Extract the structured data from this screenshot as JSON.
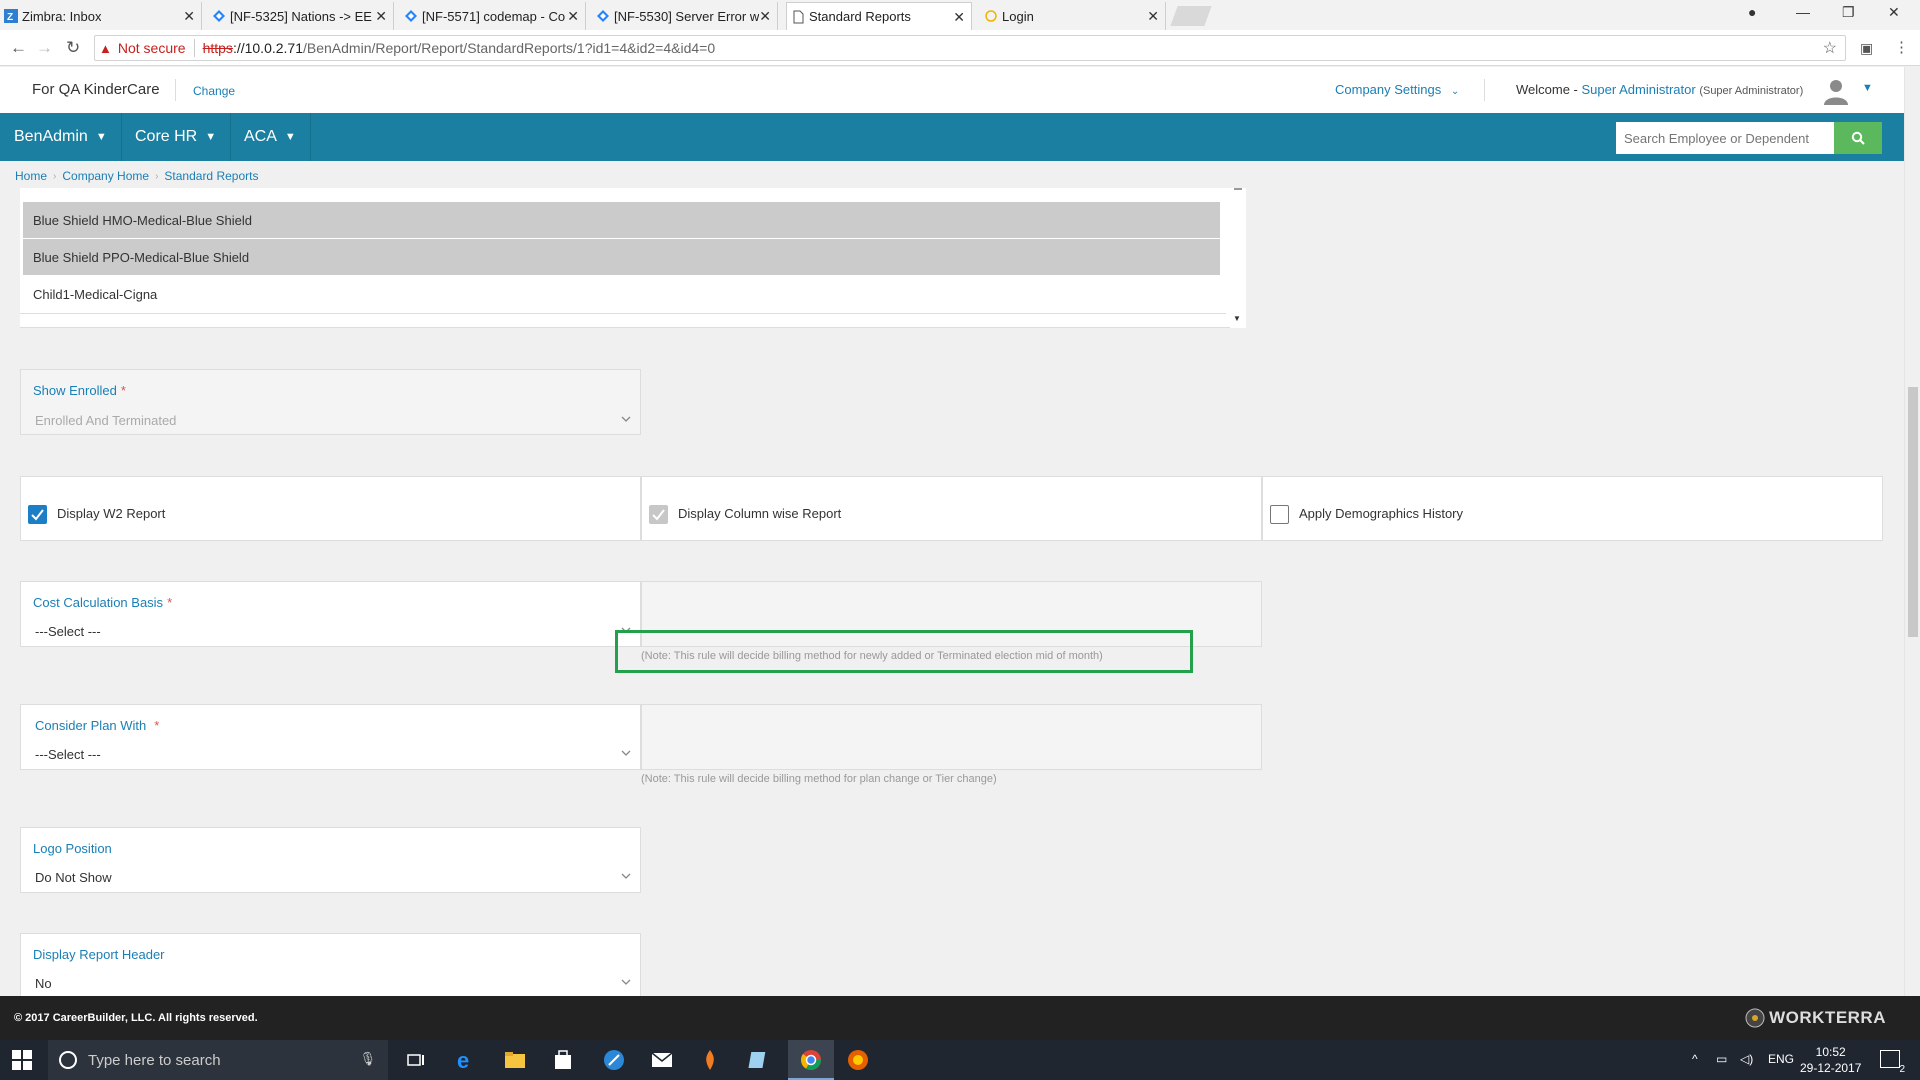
{
  "browser": {
    "tabs": [
      {
        "label": "Zimbra: Inbox",
        "icon": "zimbra-icon"
      },
      {
        "label": "[NF-5325] Nations -> EE",
        "icon": "jira-icon"
      },
      {
        "label": "[NF-5571] codemap - Co",
        "icon": "jira-icon"
      },
      {
        "label": "[NF-5530] Server Error w",
        "icon": "jira-icon"
      },
      {
        "label": "Standard Reports",
        "icon": "page-icon"
      },
      {
        "label": "Login",
        "icon": "loading-icon"
      }
    ],
    "not_secure": "Not secure",
    "url_scheme": "https",
    "url_host": "://10.0.2.71",
    "url_path": "/BenAdmin/Report/Report/StandardReports/1?id1=4&id2=4&id4=0"
  },
  "header": {
    "company": "For QA KinderCare",
    "change": "Change",
    "company_settings": "Company Settings",
    "welcome": "Welcome -",
    "user": "Super Administrator",
    "role": "(Super Administrator)"
  },
  "nav": {
    "items": [
      "BenAdmin",
      "Core HR",
      "ACA"
    ],
    "search_placeholder": "Search Employee or Dependent"
  },
  "breadcrumb": [
    "Home",
    "Company Home",
    "Standard Reports"
  ],
  "plans": [
    {
      "label": "Blue Shield HMO-Medical-Blue Shield",
      "selected": true
    },
    {
      "label": "Blue Shield PPO-Medical-Blue Shield",
      "selected": true
    },
    {
      "label": "Child1-Medical-Cigna",
      "selected": false
    }
  ],
  "form": {
    "show_enrolled": {
      "label": "Show Enrolled",
      "value": "Enrolled And Terminated"
    },
    "checkboxes": [
      {
        "label": "Display W2 Report",
        "state": "checked"
      },
      {
        "label": "Display Column wise Report",
        "state": "disabled-checked"
      },
      {
        "label": "Apply Demographics History",
        "state": "unchecked"
      }
    ],
    "cost_basis": {
      "label": "Cost Calculation Basis",
      "value": "---Select ---",
      "note": "(Note: This rule will decide billing method for newly added or Terminated election mid of month)"
    },
    "consider_plan": {
      "label": "Consider Plan With",
      "value": "---Select ---",
      "note": "(Note: This rule will decide billing method for plan change or Tier change)"
    },
    "logo_position": {
      "label": "Logo Position",
      "value": "Do Not Show"
    },
    "report_header": {
      "label": "Display Report Header",
      "value": "No"
    }
  },
  "footer": {
    "copyright": "© 2017 CareerBuilder, LLC. All rights reserved.",
    "brand": "WORKTERRA"
  },
  "taskbar": {
    "search_placeholder": "Type here to search",
    "lang": "ENG",
    "time": "10:52",
    "date": "29-12-2017",
    "notifications": "2"
  },
  "colors": {
    "nav_bg": "#1a7fa1",
    "link": "#1a7fb5",
    "search_btn": "#5cb85c",
    "highlight": "#22a04b"
  }
}
